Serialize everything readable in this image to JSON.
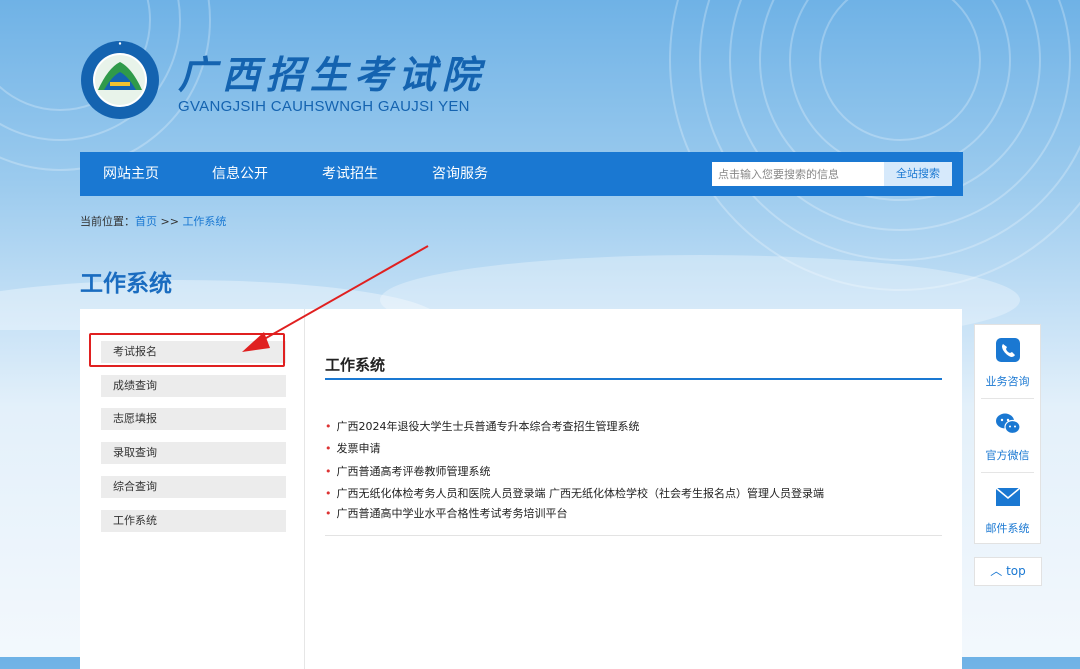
{
  "header": {
    "brand_cn": "广西招生考试院",
    "brand_en": "GVANGJSIH CAUHSWNGH GAUJSI YEN",
    "logo_ring_text": "GVANGJSIH CAUHSWNGH GAUJSI YEN"
  },
  "nav": {
    "items": [
      "网站主页",
      "信息公开",
      "考试招生",
      "咨询服务"
    ],
    "search_placeholder": "点击输入您要搜索的信息",
    "search_button": "全站搜索"
  },
  "breadcrumb": {
    "label": "当前位置：",
    "home": "首页",
    "sep": " >> ",
    "current": "工作系统"
  },
  "page_title": "工作系统",
  "sidebar": {
    "items": [
      "考试报名",
      "成绩查询",
      "志愿填报",
      "录取查询",
      "综合查询",
      "工作系统"
    ]
  },
  "content": {
    "title": "工作系统",
    "links": [
      "广西2024年退役大学生士兵普通专升本综合考查招生管理系统",
      "发票申请",
      "广西普通高考评卷教师管理系统",
      "广西无纸化体检考务人员和医院人员登录端",
      "广西无纸化体检学校（社会考生报名点）管理人员登录端",
      "广西普通高中学业水平合格性考试考务培训平台"
    ]
  },
  "float_bar": {
    "items": [
      "业务咨询",
      "官方微信",
      "邮件系统"
    ],
    "top_label": "top"
  },
  "colors": {
    "nav_blue": "#1a78d2",
    "title_blue": "#1a6cc0",
    "highlight_red": "#e02020"
  }
}
